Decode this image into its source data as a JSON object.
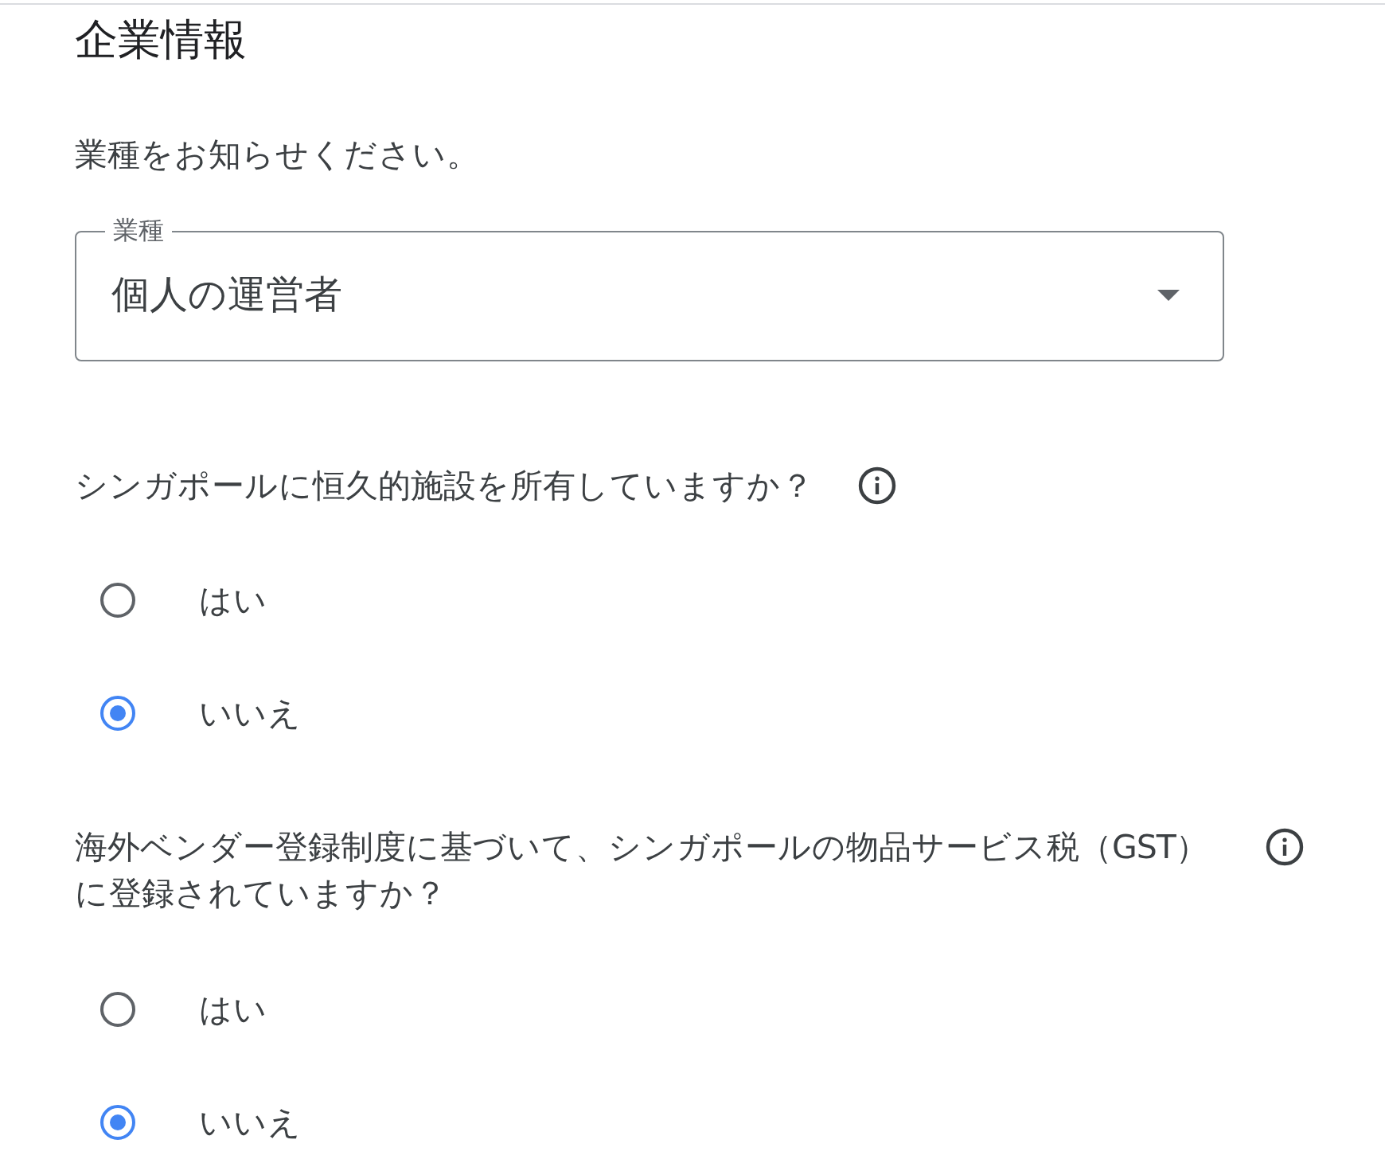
{
  "section_title": "企業情報",
  "prompt": "業種をお知らせください。",
  "industry_select": {
    "label": "業種",
    "value": "個人の運営者"
  },
  "questions": [
    {
      "text": "シンガポールに恒久的施設を所有していますか？",
      "options": [
        {
          "label": "はい",
          "selected": false
        },
        {
          "label": "いいえ",
          "selected": true
        }
      ]
    },
    {
      "text": "海外ベンダー登録制度に基づいて、シンガポールの物品サービス税（GST）に登録されていますか？",
      "options": [
        {
          "label": "はい",
          "selected": false
        },
        {
          "label": "いいえ",
          "selected": true
        }
      ]
    }
  ]
}
